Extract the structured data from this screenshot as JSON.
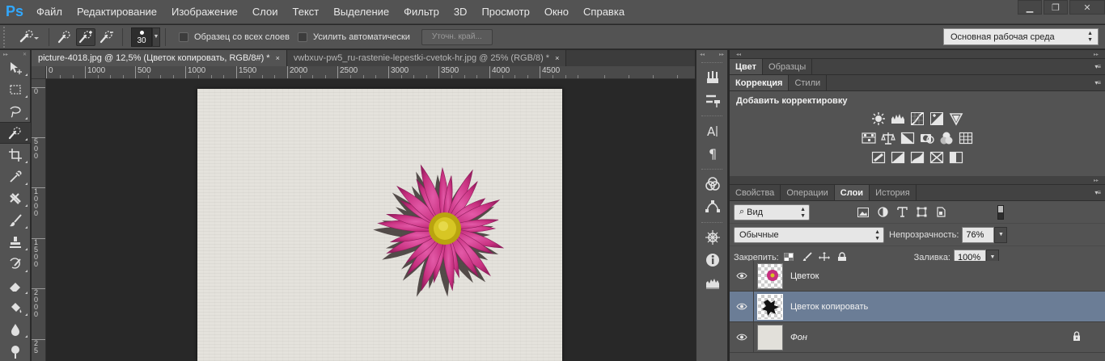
{
  "app": {
    "logo": "Ps"
  },
  "menu": [
    "Файл",
    "Редактирование",
    "Изображение",
    "Слои",
    "Текст",
    "Выделение",
    "Фильтр",
    "3D",
    "Просмотр",
    "Окно",
    "Справка"
  ],
  "window_controls": {
    "minimize": "▁",
    "restore": "❐",
    "close": "✕"
  },
  "options": {
    "brush_size": "30",
    "sample_all_layers": "Образец со всех слоев",
    "auto_enhance": "Усилить автоматически",
    "refine_edge": "Уточн. край...",
    "workspace": "Основная рабочая среда"
  },
  "tabs": [
    {
      "title": "picture-4018.jpg @ 12,5% (Цветок копировать, RGB/8#) *",
      "close": "×"
    },
    {
      "title": "vwbxuv-pw5_ru-rastenie-lepestki-cvetok-hr.jpg @ 25% (RGB/8) *",
      "close": "×"
    }
  ],
  "hruler": [
    "0",
    "1000",
    "500",
    "1000",
    "1500",
    "2000",
    "2500",
    "3000",
    "3500",
    "4000",
    "4500"
  ],
  "vruler": [
    "0",
    "5 0 0",
    "1 0 0 0",
    "1 5 0 0",
    "2 0 0 0",
    "2 5"
  ],
  "panels": {
    "top_tabs": [
      "Цвет",
      "Образцы"
    ],
    "adj_tabs": [
      "Коррекция",
      "Стили"
    ],
    "adj_title": "Добавить корректировку",
    "layer_tabs": [
      "Свойства",
      "Операции",
      "Слои",
      "История"
    ],
    "filter_kind": "Вид",
    "blend_mode": "Обычные",
    "opacity_label": "Непрозрачность:",
    "opacity_value": "76%",
    "lock_label": "Закрепить:",
    "fill_label": "Заливка:",
    "fill_value": "100%"
  },
  "layers": [
    {
      "name": "Цветок",
      "selected": false
    },
    {
      "name": "Цветок копировать",
      "selected": true
    },
    {
      "name": "Фон",
      "selected": false,
      "locked": true
    }
  ],
  "colors": {
    "accent_logo": "#31a8ff",
    "selected_layer": "#6b7d96",
    "flower": "#c0287e",
    "flower_center": "#c9b81a"
  }
}
